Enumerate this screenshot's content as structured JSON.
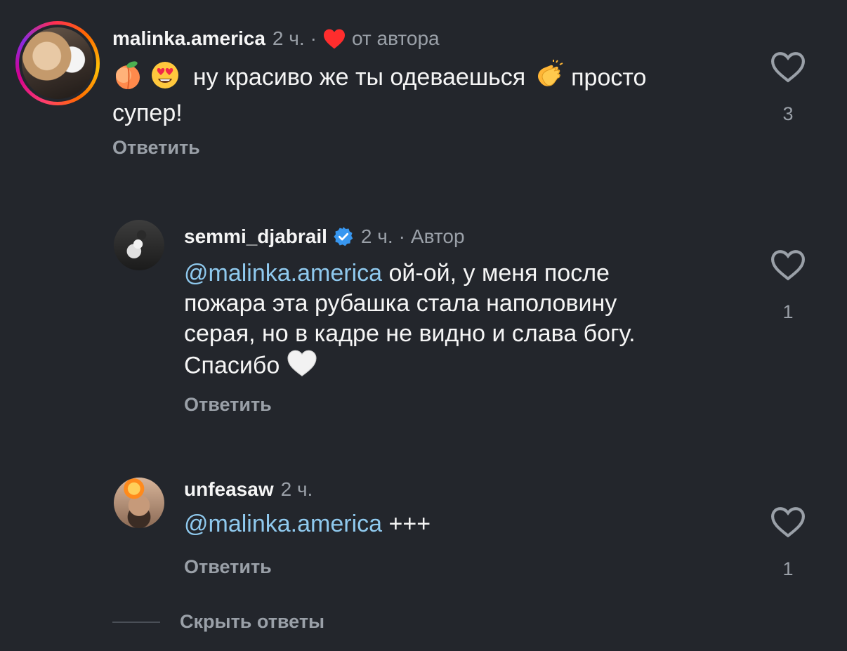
{
  "comments": [
    {
      "username": "malinka.america",
      "time": "2 ч.",
      "separator": "·",
      "badge": "от автора",
      "emojis_before": [
        "peach-emoji",
        "heart-eyes-emoji"
      ],
      "text_part1": "ну красиво же ты одеваешься",
      "clap_emoji": "clapping-hands-emoji",
      "text_part2": "просто",
      "text_line2": "супер!",
      "reply_label": "Ответить",
      "like_count": "3"
    },
    {
      "username": "semmi_djabrail",
      "time": "2 ч.",
      "separator": "·",
      "badge": "Автор",
      "mention": "@malinka.america",
      "text_line1": "ой-ой, у меня после",
      "text_line2": "пожара эта рубашка стала наполовину",
      "text_line3": "серая, но в кадре не видно и слава богу.",
      "text_line4": "Спасибо",
      "trailing_emoji": "white-heart-emoji",
      "reply_label": "Ответить",
      "like_count": "1"
    },
    {
      "username": "unfeasaw",
      "time": "2 ч.",
      "mention": "@malinka.america",
      "text": "+++",
      "reply_label": "Ответить",
      "like_count": "1"
    }
  ],
  "hide_replies_label": "Скрыть ответы",
  "colors": {
    "background": "#23262c",
    "mention": "#8fc9ee",
    "muted": "#9aa0a8",
    "author_heart": "#ff2d2d",
    "verified": "#3897f0"
  }
}
